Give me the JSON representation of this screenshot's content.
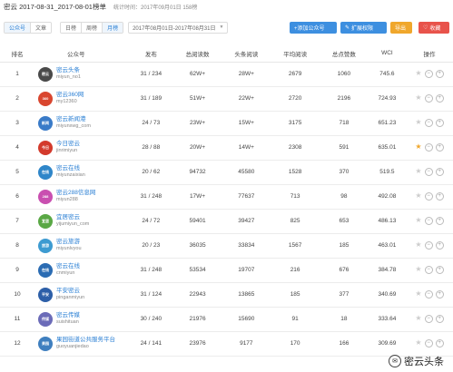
{
  "header": {
    "title": "密云 2017-08-31_2017-08-01榜单",
    "meta": "统计时间：2017年09月01日 158榜"
  },
  "toolbar": {
    "type_tabs": [
      "公众号",
      "文章"
    ],
    "period_tabs": [
      "日榜",
      "周榜",
      "月榜"
    ],
    "date_range": "2017年08月01日-2017年08月31日",
    "add_label": "+添加公众号",
    "expand_label": "扩展权限",
    "export_label": "导出",
    "fav_label": "收藏"
  },
  "columns": [
    "排名",
    "公众号",
    "发布",
    "总阅读数",
    "头条阅读",
    "平均阅读",
    "总点赞数",
    "WCI",
    "操作"
  ],
  "rows": [
    {
      "rank": "1",
      "name": "密云头条",
      "id": "miyun_no1",
      "publish": "31 / 234",
      "total_read": "62W+",
      "head_read": "28W+",
      "avg_read": "2679",
      "likes": "1060",
      "wci": "745.6",
      "starred": false,
      "avatar_color": "#4a4a4a",
      "avatar_text": "密云"
    },
    {
      "rank": "2",
      "name": "密云360网",
      "id": "my12360",
      "publish": "31 / 189",
      "total_read": "51W+",
      "head_read": "22W+",
      "avg_read": "2720",
      "likes": "2196",
      "wci": "724.93",
      "starred": false,
      "avatar_color": "#d9462f",
      "avatar_text": "360"
    },
    {
      "rank": "3",
      "name": "密云新闻港",
      "id": "miyunxwg_com",
      "publish": "24 / 73",
      "total_read": "23W+",
      "head_read": "15W+",
      "avg_read": "3175",
      "likes": "718",
      "wci": "651.23",
      "starred": false,
      "avatar_color": "#3a7bc8",
      "avatar_text": "新闻"
    },
    {
      "rank": "4",
      "name": "今日密云",
      "id": "jinrimiyun",
      "publish": "28 / 88",
      "total_read": "20W+",
      "head_read": "14W+",
      "avg_read": "2308",
      "likes": "591",
      "wci": "635.01",
      "starred": true,
      "avatar_color": "#d33a2c",
      "avatar_text": "今日"
    },
    {
      "rank": "5",
      "name": "密云在线",
      "id": "miyunzaixian",
      "publish": "20 / 62",
      "total_read": "94732",
      "head_read": "45580",
      "avg_read": "1528",
      "likes": "370",
      "wci": "519.5",
      "starred": false,
      "avatar_color": "#2f86c9",
      "avatar_text": "在线"
    },
    {
      "rank": "6",
      "name": "密云288信息网",
      "id": "miyun288",
      "publish": "31 / 248",
      "total_read": "17W+",
      "head_read": "77637",
      "avg_read": "713",
      "likes": "98",
      "wci": "492.08",
      "starred": false,
      "avatar_color": "#c94fb0",
      "avatar_text": "288"
    },
    {
      "rank": "7",
      "name": "宜居密云",
      "id": "yijumiyun_com",
      "publish": "24 / 72",
      "total_read": "59401",
      "head_read": "39427",
      "avg_read": "825",
      "likes": "653",
      "wci": "486.13",
      "starred": false,
      "avatar_color": "#5aa845",
      "avatar_text": "宜居"
    },
    {
      "rank": "8",
      "name": "密云旅游",
      "id": "miyunlvyou",
      "publish": "20 / 23",
      "total_read": "36035",
      "head_read": "33834",
      "avg_read": "1567",
      "likes": "185",
      "wci": "463.01",
      "starred": false,
      "avatar_color": "#3d9bd1",
      "avatar_text": "旅游"
    },
    {
      "rank": "9",
      "name": "密云在线",
      "id": "cnmiyun",
      "publish": "31 / 248",
      "total_read": "53534",
      "head_read": "19707",
      "avg_read": "216",
      "likes": "676",
      "wci": "384.78",
      "starred": false,
      "avatar_color": "#2b6cb3",
      "avatar_text": "在线"
    },
    {
      "rank": "10",
      "name": "平安密云",
      "id": "pinganmiyun",
      "publish": "31 / 124",
      "total_read": "22943",
      "head_read": "13865",
      "avg_read": "185",
      "likes": "377",
      "wci": "340.69",
      "starred": false,
      "avatar_color": "#2d5fa8",
      "avatar_text": "平安"
    },
    {
      "rank": "11",
      "name": "密云传媒",
      "id": "suishituan",
      "publish": "30 / 240",
      "total_read": "21976",
      "head_read": "15690",
      "avg_read": "91",
      "likes": "18",
      "wci": "333.64",
      "starred": false,
      "avatar_color": "#6b6bb8",
      "avatar_text": "传媒"
    },
    {
      "rank": "12",
      "name": "果园街道公共服务平台",
      "id": "guoyuanjiedao",
      "publish": "24 / 141",
      "total_read": "23976",
      "head_read": "9177",
      "avg_read": "170",
      "likes": "166",
      "wci": "309.69",
      "starred": false,
      "avatar_color": "#3f7fbf",
      "avatar_text": "果园"
    }
  ],
  "watermark": "密云头条"
}
